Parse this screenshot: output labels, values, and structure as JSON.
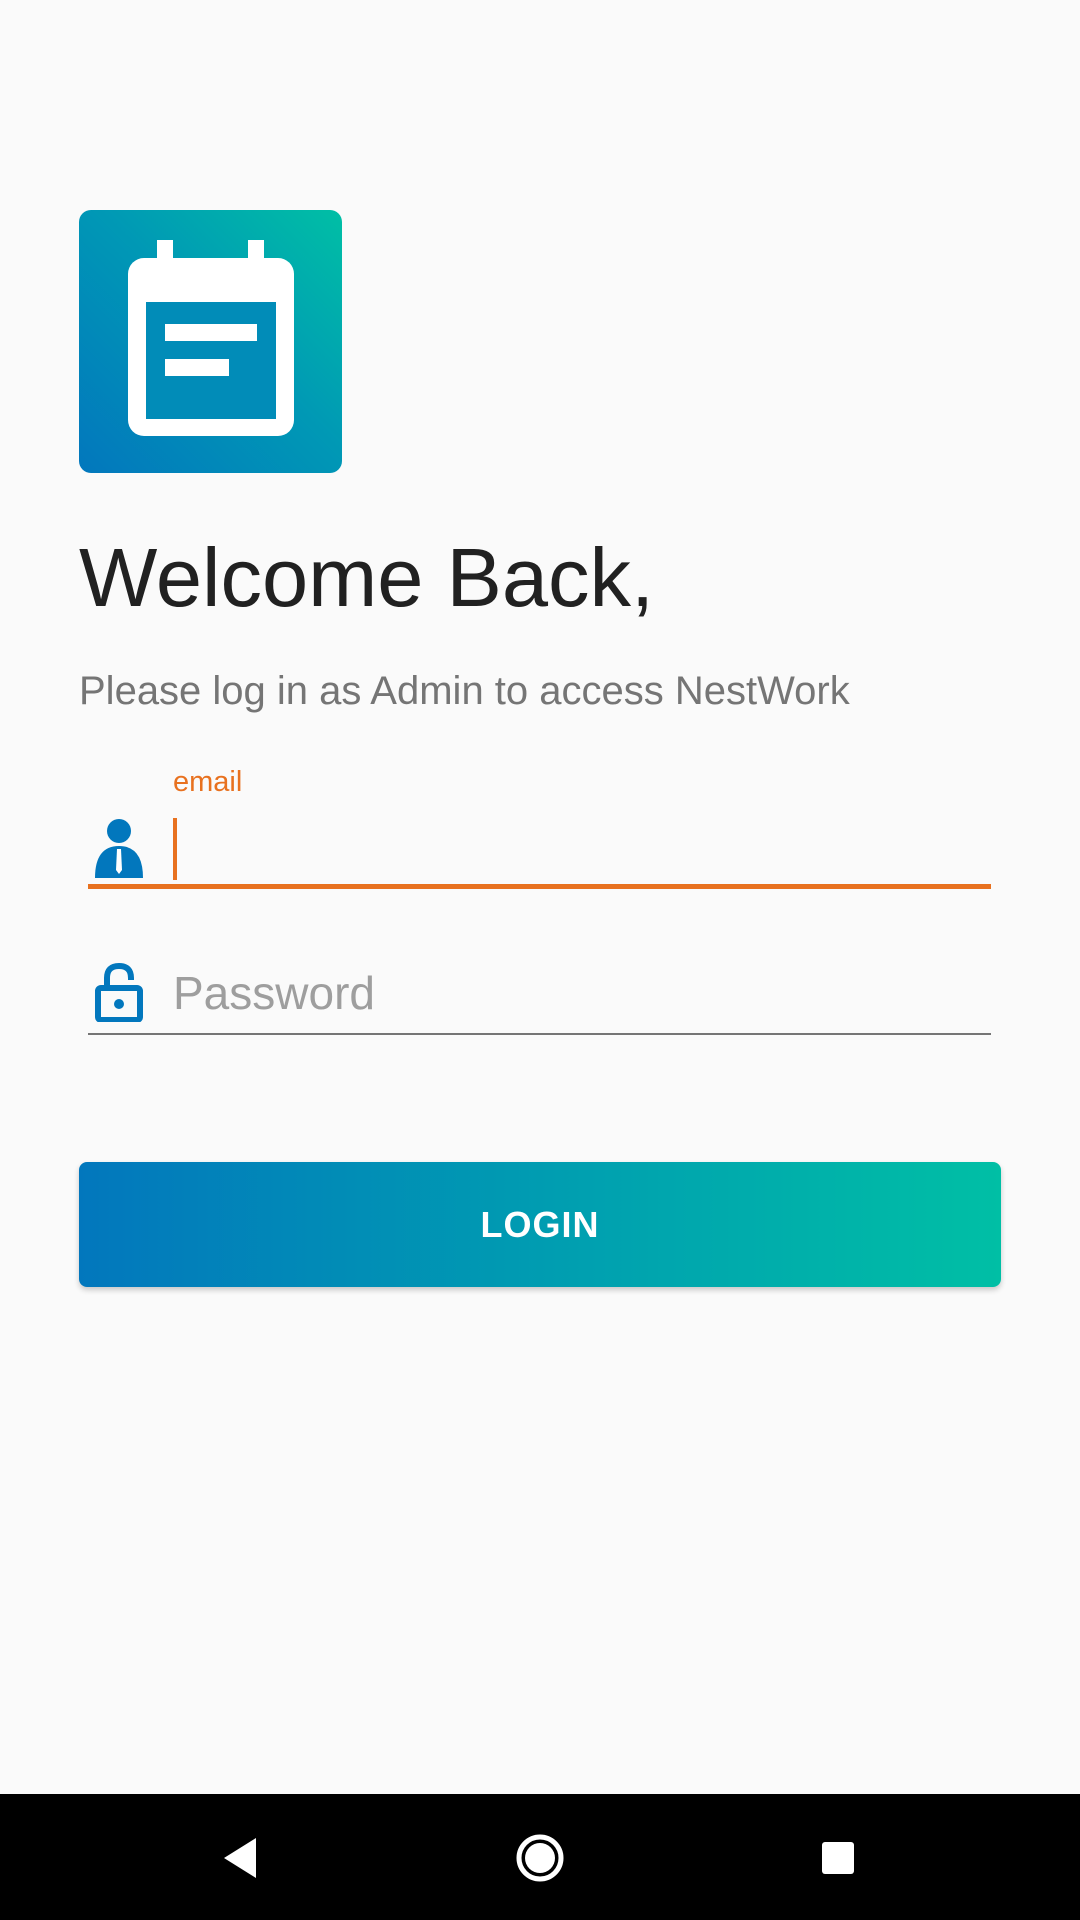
{
  "app": {
    "name": "NestWork",
    "logo_icon": "calendar-icon",
    "colors": {
      "gradient_start": "#0277bd",
      "gradient_end": "#00bfa5",
      "accent": "#e8711f",
      "background": "#fafafa"
    }
  },
  "header": {
    "title": "Welcome Back,",
    "subtitle": "Please log in as Admin to access NestWork"
  },
  "form": {
    "email": {
      "label": "email",
      "value": "",
      "icon": "user-icon",
      "focused": true
    },
    "password": {
      "placeholder": "Password",
      "value": "",
      "icon": "lock-icon"
    },
    "login_label": "LOGIN"
  },
  "navbar": {
    "back_icon": "back-triangle-icon",
    "home_icon": "home-circle-icon",
    "recents_icon": "recents-square-icon"
  }
}
